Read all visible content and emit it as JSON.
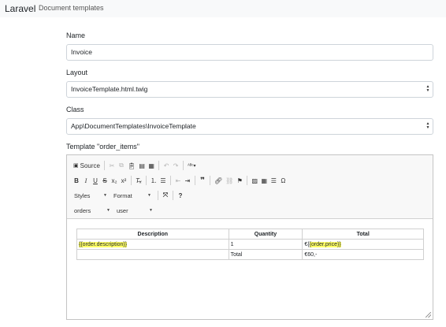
{
  "navbar": {
    "brand": "Laravel",
    "link": "Document templates"
  },
  "form": {
    "name": {
      "label": "Name",
      "value": "Invoice"
    },
    "layout": {
      "label": "Layout",
      "value": "InvoiceTemplate.html.twig"
    },
    "class": {
      "label": "Class",
      "value": "App\\DocumentTemplates\\InvoiceTemplate"
    },
    "template": {
      "label": "Template \"order_items\""
    }
  },
  "toolbar": {
    "source_label": "Source",
    "styles_label": "Styles",
    "format_label": "Format",
    "help_label": "?",
    "orders_label": "orders",
    "user_label": "user",
    "icons": [
      "source-icon",
      "cut-icon",
      "copy-icon",
      "paste-icon",
      "paste-text-icon",
      "paste-word-icon",
      "undo-icon",
      "redo-icon",
      "spellcheck-icon",
      "bold-icon",
      "italic-icon",
      "underline-icon",
      "strike-icon",
      "subscript-icon",
      "superscript-icon",
      "remove-format-icon",
      "numbered-list-icon",
      "bulleted-list-icon",
      "outdent-icon",
      "indent-icon",
      "blockquote-icon",
      "link-icon",
      "unlink-icon",
      "anchor-icon",
      "image-icon",
      "table-icon",
      "horizontal-line-icon",
      "special-char-icon",
      "maximize-icon",
      "help-icon"
    ]
  },
  "table": {
    "headers": [
      "Description",
      "Quantity",
      "Total"
    ],
    "row": {
      "description": "{{order.description}}",
      "quantity": "1",
      "total": "€{{order.price}}"
    },
    "footer": {
      "label": "Total",
      "value": "€60,-"
    }
  }
}
